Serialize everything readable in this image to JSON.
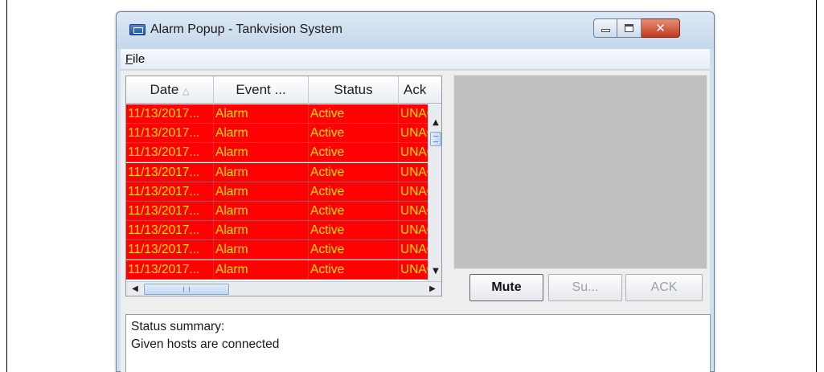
{
  "window": {
    "title": "Alarm Popup - Tankvision System",
    "close_glyph": "✕"
  },
  "menu": {
    "file": "File"
  },
  "table": {
    "columns": [
      "Date",
      "Event ...",
      "Status",
      "Ack"
    ],
    "sort_indicator": "△",
    "rows": [
      [
        "11/13/2017...",
        "Alarm",
        "Active",
        "UNAC"
      ],
      [
        "11/13/2017...",
        "Alarm",
        "Active",
        "UNAC"
      ],
      [
        "11/13/2017...",
        "Alarm",
        "Active",
        "UNAC"
      ],
      [
        "11/13/2017...",
        "Alarm",
        "Active",
        "UNAC"
      ],
      [
        "11/13/2017...",
        "Alarm",
        "Active",
        "UNAC"
      ],
      [
        "11/13/2017...",
        "Alarm",
        "Active",
        "UNAC"
      ],
      [
        "11/13/2017...",
        "Alarm",
        "Active",
        "UNAC"
      ],
      [
        "11/13/2017...",
        "Alarm",
        "Active",
        "UNAC"
      ],
      [
        "11/13/2017...",
        "Alarm",
        "Active",
        "UNAC"
      ]
    ],
    "row_colors": {
      "background": "#ff0000",
      "text": "#ffe100"
    },
    "scroll_up": "▲",
    "scroll_down": "▼",
    "scroll_left": "◀",
    "scroll_right": "▶"
  },
  "buttons": {
    "mute": "Mute",
    "suppress": "Su...",
    "ack": "ACK"
  },
  "status": {
    "line1": "Status summary:",
    "line2": "Given hosts are connected"
  }
}
